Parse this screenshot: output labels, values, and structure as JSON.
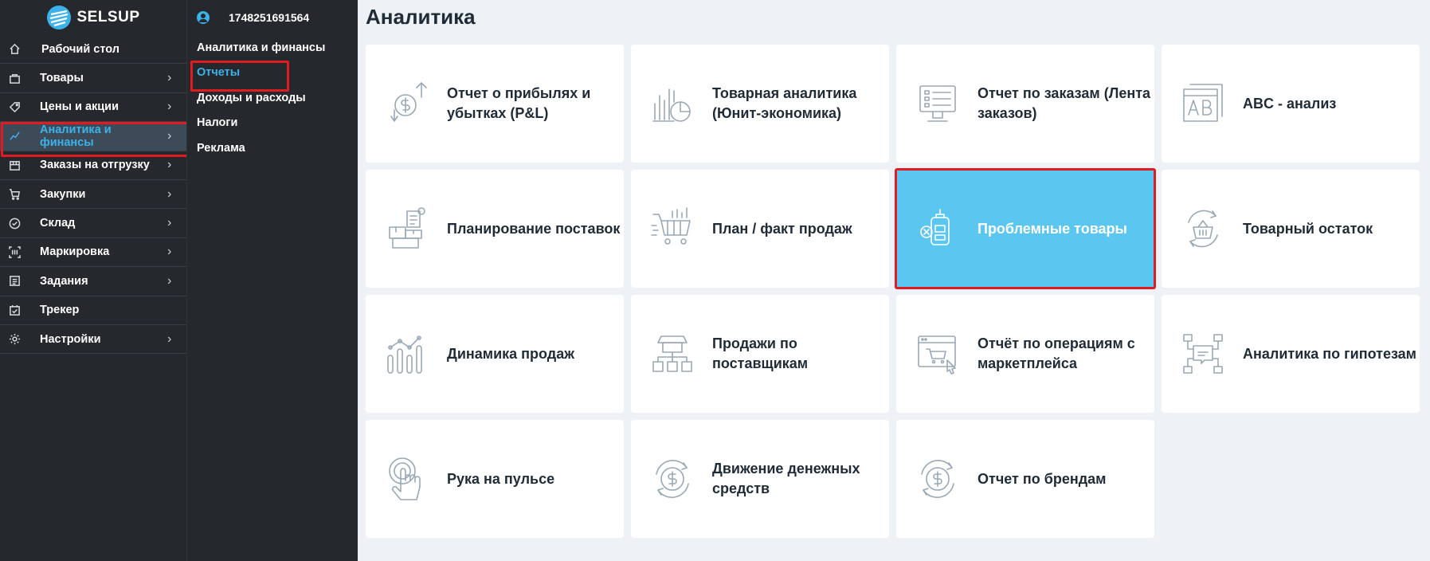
{
  "brand": {
    "logo_text": "SELSUP"
  },
  "user": {
    "id": "1748251691564"
  },
  "sidebar": {
    "items": [
      {
        "label": "Рабочий стол",
        "icon": "home-icon",
        "has_chevron": false,
        "active": false
      },
      {
        "label": "Товары",
        "icon": "bag-icon",
        "has_chevron": true,
        "active": false
      },
      {
        "label": "Цены и акции",
        "icon": "tag-icon",
        "has_chevron": true,
        "active": false
      },
      {
        "label": "Аналитика и финансы",
        "icon": "chart-line-icon",
        "has_chevron": true,
        "active": true
      },
      {
        "label": "Заказы на отгрузку",
        "icon": "box-icon",
        "has_chevron": true,
        "active": false
      },
      {
        "label": "Закупки",
        "icon": "cart-icon",
        "has_chevron": true,
        "active": false
      },
      {
        "label": "Склад",
        "icon": "check-circle-icon",
        "has_chevron": true,
        "active": false
      },
      {
        "label": "Маркировка",
        "icon": "barcode-icon",
        "has_chevron": true,
        "active": false
      },
      {
        "label": "Задания",
        "icon": "tasks-icon",
        "has_chevron": true,
        "active": false
      },
      {
        "label": "Трекер",
        "icon": "calendar-check-icon",
        "has_chevron": false,
        "active": false
      },
      {
        "label": "Настройки",
        "icon": "gear-icon",
        "has_chevron": true,
        "active": false
      }
    ]
  },
  "subnav": {
    "heading": "Аналитика и финансы",
    "items": [
      {
        "label": "Отчеты",
        "current": true
      },
      {
        "label": "Доходы и расходы",
        "current": false
      },
      {
        "label": "Налоги",
        "current": false
      },
      {
        "label": "Реклама",
        "current": false
      }
    ]
  },
  "page": {
    "title": "Аналитика"
  },
  "cards": [
    {
      "title": "Отчет о прибылях и убытках (P&L)",
      "icon": "profit-loss-icon"
    },
    {
      "title": "Товарная аналитика (Юнит-экономика)",
      "icon": "product-analytics-icon"
    },
    {
      "title": "Отчет по заказам (Лента заказов)",
      "icon": "orders-report-icon"
    },
    {
      "title": "ABC - анализ",
      "icon": "abc-analysis-icon"
    },
    {
      "title": "Планирование поставок",
      "icon": "supply-planning-icon"
    },
    {
      "title": "План / факт продаж",
      "icon": "plan-fact-icon"
    },
    {
      "title": "Проблемные товары",
      "icon": "problem-products-icon",
      "highlighted": true
    },
    {
      "title": "Товарный остаток",
      "icon": "stock-balance-icon"
    },
    {
      "title": "Динамика продаж",
      "icon": "sales-dynamics-icon"
    },
    {
      "title": "Продажи по поставщикам",
      "icon": "suppliers-sales-icon"
    },
    {
      "title": "Отчёт по операциям с маркетплейса",
      "icon": "marketplace-operations-icon"
    },
    {
      "title": "Аналитика по гипотезам",
      "icon": "hypotheses-icon"
    },
    {
      "title": "Рука на пульсе",
      "icon": "hand-pulse-icon"
    },
    {
      "title": "Движение денежных средств",
      "icon": "cash-flow-icon"
    },
    {
      "title": "Отчет по брендам",
      "icon": "brands-report-icon"
    }
  ],
  "colors": {
    "accent": "#3bb3ea",
    "highlight_card": "#5bc6ef",
    "sidebar_bg": "#25282c",
    "annotation_red": "#e01b22"
  }
}
